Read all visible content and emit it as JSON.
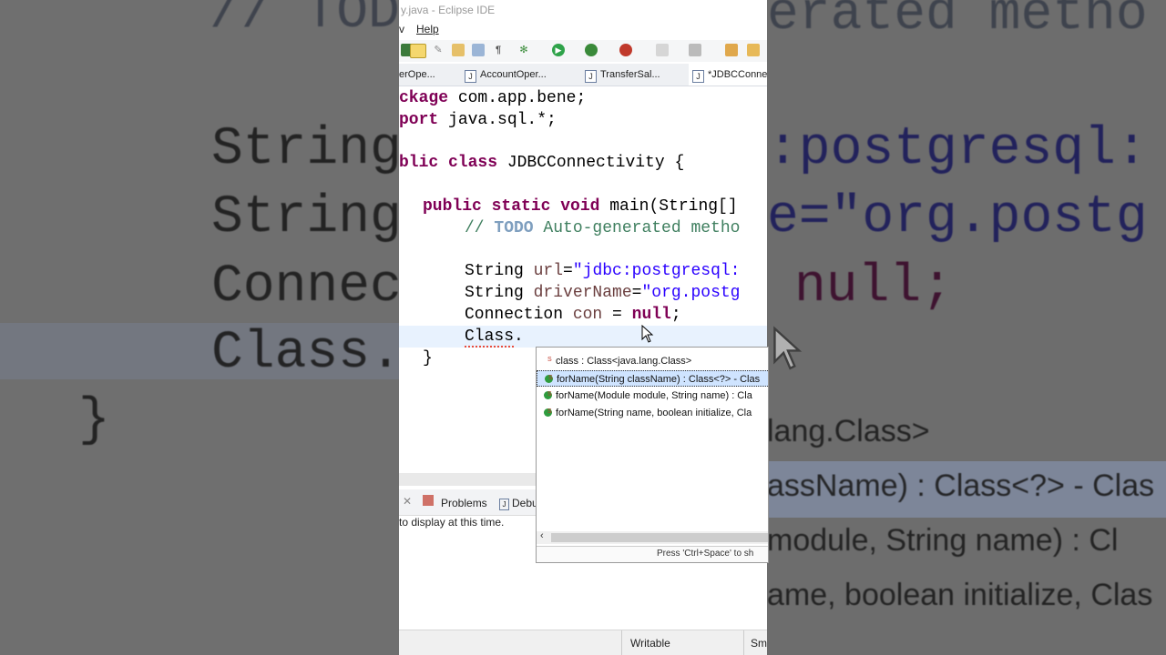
{
  "window": {
    "title": "y.java - Eclipse IDE"
  },
  "menu": [
    "v",
    "Help"
  ],
  "tabs": [
    {
      "label": "erOpe..."
    },
    {
      "label": "AccountOper..."
    },
    {
      "label": "TransferSal..."
    },
    {
      "label": "*JDBCConne"
    }
  ],
  "editor": {
    "lines": [
      "ckage com.app.bene;",
      "port java.sql.*;",
      "",
      "blic class JDBCConnectivity {",
      "",
      "  public static void main(String[]",
      "      // TODO Auto-generated metho",
      "",
      "      String url=\"jdbc:postgresql:",
      "      String driverName=\"org.postg",
      "      Connection con = null;",
      "      Class.",
      "  }"
    ]
  },
  "content_assist": {
    "items": [
      "class : Class<java.lang.Class>",
      "forName(String className) : Class<?> - Clas",
      "forName(Module module, String name) : Cla",
      "forName(String name, boolean initialize, Cla"
    ],
    "selected_index": 1,
    "hint": "Press 'Ctrl+Space' to sh"
  },
  "bottom_panel": {
    "tabs": [
      "Problems",
      "Debu"
    ],
    "message": "to display at this time."
  },
  "status": {
    "writable": "Writable",
    "insert": "Sma"
  },
  "background_zoom": {
    "left_lines": [
      "// TODO",
      "String",
      "String",
      "Connec",
      "Class.",
      "}"
    ],
    "right_lines": [
      "erated metho",
      ":postgresql:",
      "e=\"org.postg",
      "null;",
      "lang.Class>",
      "assName) : Class<?> - Clas",
      "module, String name) : Cl",
      "ame, boolean initialize, Clas"
    ]
  },
  "colors": {
    "keyword": "#7f0055",
    "string": "#2a00ff",
    "comment": "#3f7f5f",
    "selection": "#cfe4ff",
    "current_line": "#e8f2fe"
  }
}
